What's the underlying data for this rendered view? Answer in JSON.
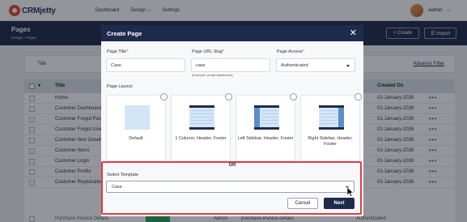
{
  "app": {
    "logo_text": "CRMjetty",
    "nav": [
      "Dashboard",
      "Design",
      "Settings"
    ],
    "nav_design_caret": "⌵",
    "user": "Admin",
    "user_caret": "⌵"
  },
  "page": {
    "title": "Pages",
    "breadcrumb": "Design  ›  Pages",
    "create_label": "+  Create",
    "import_label": "☰  Import"
  },
  "filter": {
    "title_label": "Title",
    "advance_filter": "Advance Filter"
  },
  "table": {
    "col_title": "Title",
    "col_created": "Created On",
    "sort_caret": "▾",
    "row_action": "•••",
    "rows": [
      {
        "title": "Home",
        "created": "01-January-2026"
      },
      {
        "title": "Customer Dashboard",
        "created": "01-January-2026"
      },
      {
        "title": "Customer Forgot Pass",
        "created": "01-January-2026"
      },
      {
        "title": "Customer Forgot User",
        "created": "01-January-2026"
      },
      {
        "title": "Customer Item Details",
        "created": "01-January-2026"
      },
      {
        "title": "Customer Items",
        "created": "01-January-2026"
      },
      {
        "title": "Customer Login",
        "created": "01-January-2026"
      },
      {
        "title": "Customer Profile",
        "created": "01-January-2026"
      },
      {
        "title": "Customer Registration",
        "created": "01-January-2026"
      }
    ],
    "partial_row": {
      "title": "Purchase Invoice Details",
      "col_a": "Admin",
      "col_b": "purchase-invoice-details",
      "col_c": "Authenticated"
    }
  },
  "modal": {
    "title": "Create Page",
    "close": "✕",
    "page_title_label": "Page Title",
    "page_title_value": "Case",
    "slug_label": "Page URL Slug",
    "slug_value": "case",
    "slug_hint": "(Example: portal-dashboard)",
    "access_label": "Page Access",
    "access_value": "Authenticated",
    "required_mark": "*",
    "layout_label": "Page Layout:",
    "layouts": [
      {
        "name": "Default"
      },
      {
        "name": "1 Column, Header, Footer"
      },
      {
        "name": "Left Sidebar, Header, Footer"
      },
      {
        "name": "Right Sidebar, Header, Footer"
      }
    ],
    "or_label": "OR",
    "template_label": "Select Template",
    "template_value": "Case",
    "cancel_label": "Cancel",
    "next_label": "Next"
  },
  "colors": {
    "navy": "#1f2b4d",
    "highlight": "#e23b45",
    "brand": "#e8472f"
  }
}
